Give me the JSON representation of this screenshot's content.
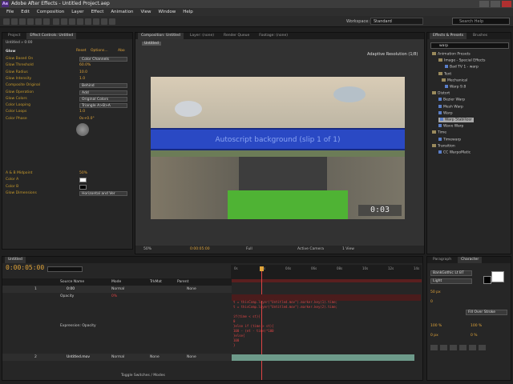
{
  "window": {
    "title": "Adobe After Effects - Untitled Project.aep",
    "app_badge": "Ae"
  },
  "menu": [
    "File",
    "Edit",
    "Composition",
    "Layer",
    "Effect",
    "Animation",
    "View",
    "Window",
    "Help"
  ],
  "toolbar": {
    "workspace_label": "Workspace:",
    "workspace_value": "Standard",
    "search_placeholder": "Search Help"
  },
  "project_panel": {
    "tabs": [
      "Project",
      "Effect Controls: Untitled"
    ],
    "layer_ref": "Untitled » 0:00"
  },
  "effect_controls": {
    "header": {
      "effect": "Glow",
      "reset": "Reset",
      "options": "Options...",
      "about": "Abo"
    },
    "rows": [
      {
        "label": "Glow Based On",
        "value": "Color Channels",
        "kind": "dropdown"
      },
      {
        "label": "Glow Threshold",
        "value": "60.0%",
        "kind": "value"
      },
      {
        "label": "Glow Radius",
        "value": "10.0",
        "kind": "value"
      },
      {
        "label": "Glow Intensity",
        "value": "1.0",
        "kind": "value"
      },
      {
        "label": "Composite Original",
        "value": "Behind",
        "kind": "dropdown"
      },
      {
        "label": "Glow Operation",
        "value": "Add",
        "kind": "dropdown"
      },
      {
        "label": "Glow Colors",
        "value": "Original Colors",
        "kind": "dropdown"
      },
      {
        "label": "Color Looping",
        "value": "Triangle A>B>A",
        "kind": "dropdown"
      },
      {
        "label": "Color Loops",
        "value": "1.0",
        "kind": "value"
      },
      {
        "label": "Color Phase",
        "value": "0x+0.0°",
        "kind": "value"
      },
      {
        "label": "A & B Midpoint",
        "value": "50%",
        "kind": "value"
      },
      {
        "label": "Color A",
        "value": "",
        "kind": "swatch"
      },
      {
        "label": "Color B",
        "value": "",
        "kind": "swatch"
      },
      {
        "label": "Glow Dimensions",
        "value": "Horizontal and Ver",
        "kind": "dropdown"
      }
    ]
  },
  "composition": {
    "tabs": [
      "Composition: Untitled",
      "Layer: (none)",
      "Render Queue",
      "Footage: (none)"
    ],
    "breadcrumb": "Untitled",
    "resolution_note": "Adaptive Resolution (1/8)",
    "banner_text": "Autoscript background (slip 1 of 1)",
    "timer_text": "0:03",
    "footer": {
      "zoom": "50%",
      "timecode": "0:00:05:00",
      "resolution": "Full",
      "camera": "Active Camera",
      "views": "1 View"
    }
  },
  "effects_presets": {
    "tabs": [
      "Effects & Presets",
      "Brushes"
    ],
    "search_value": "warp",
    "items": [
      {
        "text": "Animation Presets",
        "indent": 0,
        "type": "folder"
      },
      {
        "text": "Image - Special Effects",
        "indent": 2,
        "type": "folder"
      },
      {
        "text": "Bad TV 1 - warp",
        "indent": 4,
        "type": "fx"
      },
      {
        "text": "Text",
        "indent": 2,
        "type": "folder"
      },
      {
        "text": "Mechanical",
        "indent": 3,
        "type": "folder"
      },
      {
        "text": "Warp 9.8",
        "indent": 4,
        "type": "fx"
      },
      {
        "text": "Distort",
        "indent": 0,
        "type": "folder"
      },
      {
        "text": "Bezier Warp",
        "indent": 2,
        "type": "fx"
      },
      {
        "text": "Mesh Warp",
        "indent": 2,
        "type": "fx"
      },
      {
        "text": "Warp",
        "indent": 2,
        "type": "fx"
      },
      {
        "text": "Warp Stabilizer",
        "indent": 2,
        "type": "fx",
        "selected": true
      },
      {
        "text": "Wave Warp",
        "indent": 2,
        "type": "fx"
      },
      {
        "text": "Time",
        "indent": 0,
        "type": "folder"
      },
      {
        "text": "Timewarp",
        "indent": 2,
        "type": "fx"
      },
      {
        "text": "Transition",
        "indent": 0,
        "type": "folder"
      },
      {
        "text": "CC WarpoMatic",
        "indent": 2,
        "type": "fx"
      }
    ]
  },
  "timeline": {
    "tab": "Untitled",
    "timecode": "0:00:05:00",
    "columns": {
      "source_name": "Source Name",
      "mode": "Mode",
      "trkmat": "TrkMat",
      "parent": "Parent"
    },
    "layer1": {
      "index": "1",
      "name": "0:00",
      "mode": "Normal",
      "parent": "None"
    },
    "opacity_label": "Opacity",
    "opacity_value": "0%",
    "expression_label": "Expression: Opacity",
    "layer2": {
      "index": "2",
      "name": "Untitled.mov",
      "mode": "Normal",
      "trkmat": "None",
      "parent": "None"
    },
    "toggle_label": "Toggle Switches / Modes",
    "ruler": [
      "0s",
      "02s",
      "04s",
      "06s",
      "08s",
      "10s",
      "12s",
      "14s"
    ],
    "expression_lines": [
      "t = thisComp.layer(\"Untitled.mov\").marker.key(1).time;",
      "t = thisComp.layer(\"Untitled.mov\").marker.key(2).time;",
      "",
      "if(time < st){",
      "0",
      "}else if (time > st){",
      "100 - (et - time)*100",
      "}else{",
      "100",
      "}"
    ]
  },
  "char_panel": {
    "tabs": [
      "Paragraph",
      "Character"
    ],
    "font": "BankGothic Lt BT",
    "style": "Light",
    "size": "50 px",
    "tracking": "0",
    "scale_v": "100 %",
    "scale_h": "100 %",
    "baseline": "0 px",
    "tsume": "0 %",
    "stroke": "Fill Over Stroke"
  },
  "colors": {
    "accent_orange": "#e0a43a",
    "banner_blue": "#2a49c4",
    "selection": "#a8a8a8",
    "time_red": "#d44444"
  }
}
